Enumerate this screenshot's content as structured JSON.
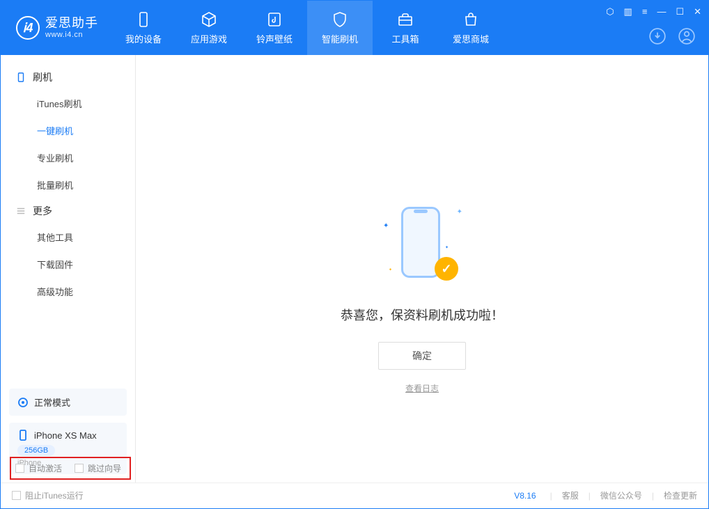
{
  "app": {
    "name": "爱思助手",
    "url": "www.i4.cn"
  },
  "tabs": {
    "device": "我的设备",
    "apps": "应用游戏",
    "ringtone": "铃声壁纸",
    "flash": "智能刷机",
    "toolbox": "工具箱",
    "store": "爱思商城"
  },
  "sidebar": {
    "section1": "刷机",
    "items1": [
      "iTunes刷机",
      "一键刷机",
      "专业刷机",
      "批量刷机"
    ],
    "section2": "更多",
    "items2": [
      "其他工具",
      "下载固件",
      "高级功能"
    ]
  },
  "mode_card": {
    "label": "正常模式"
  },
  "device_card": {
    "name": "iPhone XS Max",
    "capacity": "256GB",
    "type": "iPhone"
  },
  "content": {
    "success": "恭喜您，保资料刷机成功啦！",
    "ok": "确定",
    "view_log": "查看日志"
  },
  "checks": {
    "auto_activate": "自动激活",
    "skip_guide": "跳过向导"
  },
  "footer": {
    "block_itunes": "阻止iTunes运行",
    "version": "V8.16",
    "support": "客服",
    "wechat": "微信公众号",
    "update": "检查更新"
  }
}
